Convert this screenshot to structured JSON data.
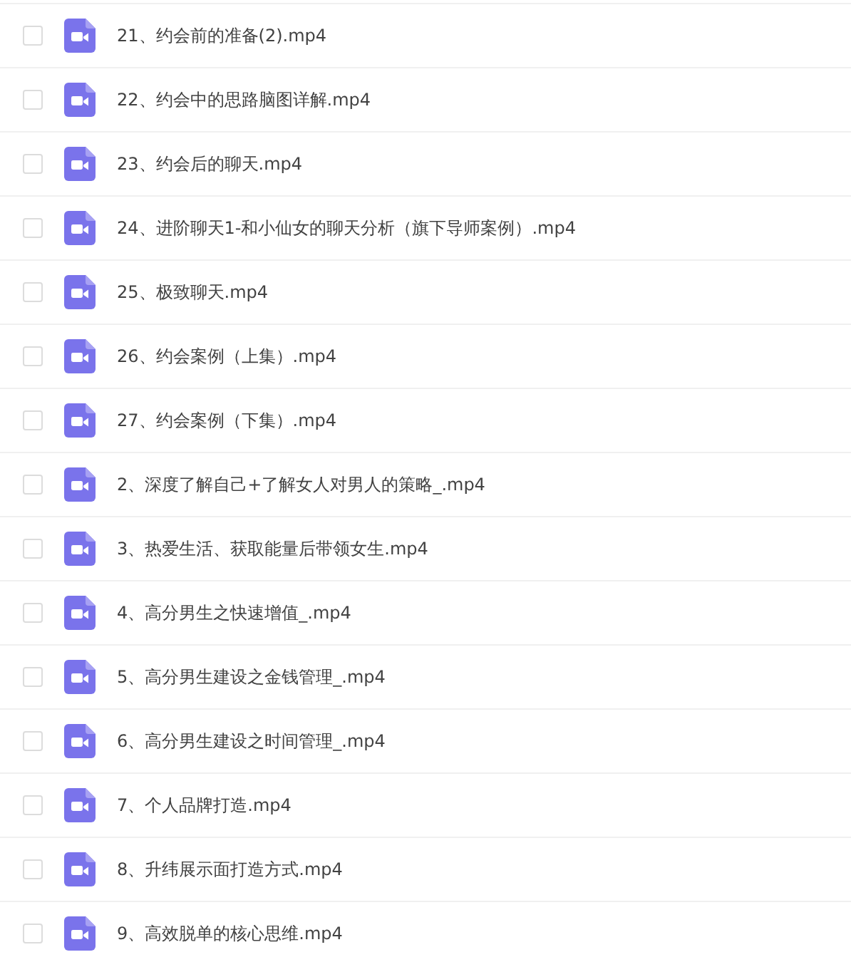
{
  "files": [
    {
      "name": "21、约会前的准备(2).mp4",
      "checked": false
    },
    {
      "name": "22、约会中的思路脑图详解.mp4",
      "checked": false
    },
    {
      "name": "23、约会后的聊天.mp4",
      "checked": false
    },
    {
      "name": "24、进阶聊天1-和小仙女的聊天分析（旗下导师案例）.mp4",
      "checked": false
    },
    {
      "name": "25、极致聊天.mp4",
      "checked": false
    },
    {
      "name": "26、约会案例（上集）.mp4",
      "checked": false
    },
    {
      "name": "27、约会案例（下集）.mp4",
      "checked": false
    },
    {
      "name": "2、深度了解自己+了解女人对男人的策略_.mp4",
      "checked": false
    },
    {
      "name": "3、热爱生活、获取能量后带领女生.mp4",
      "checked": false
    },
    {
      "name": "4、高分男生之快速增值_.mp4",
      "checked": false
    },
    {
      "name": "5、高分男生建设之金钱管理_.mp4",
      "checked": false
    },
    {
      "name": "6、高分男生建设之时间管理_.mp4",
      "checked": false
    },
    {
      "name": "7、个人品牌打造.mp4",
      "checked": false
    },
    {
      "name": "8、升纬展示面打造方式.mp4",
      "checked": false
    },
    {
      "name": "9、高效脱单的核心思维.mp4",
      "checked": false
    }
  ]
}
